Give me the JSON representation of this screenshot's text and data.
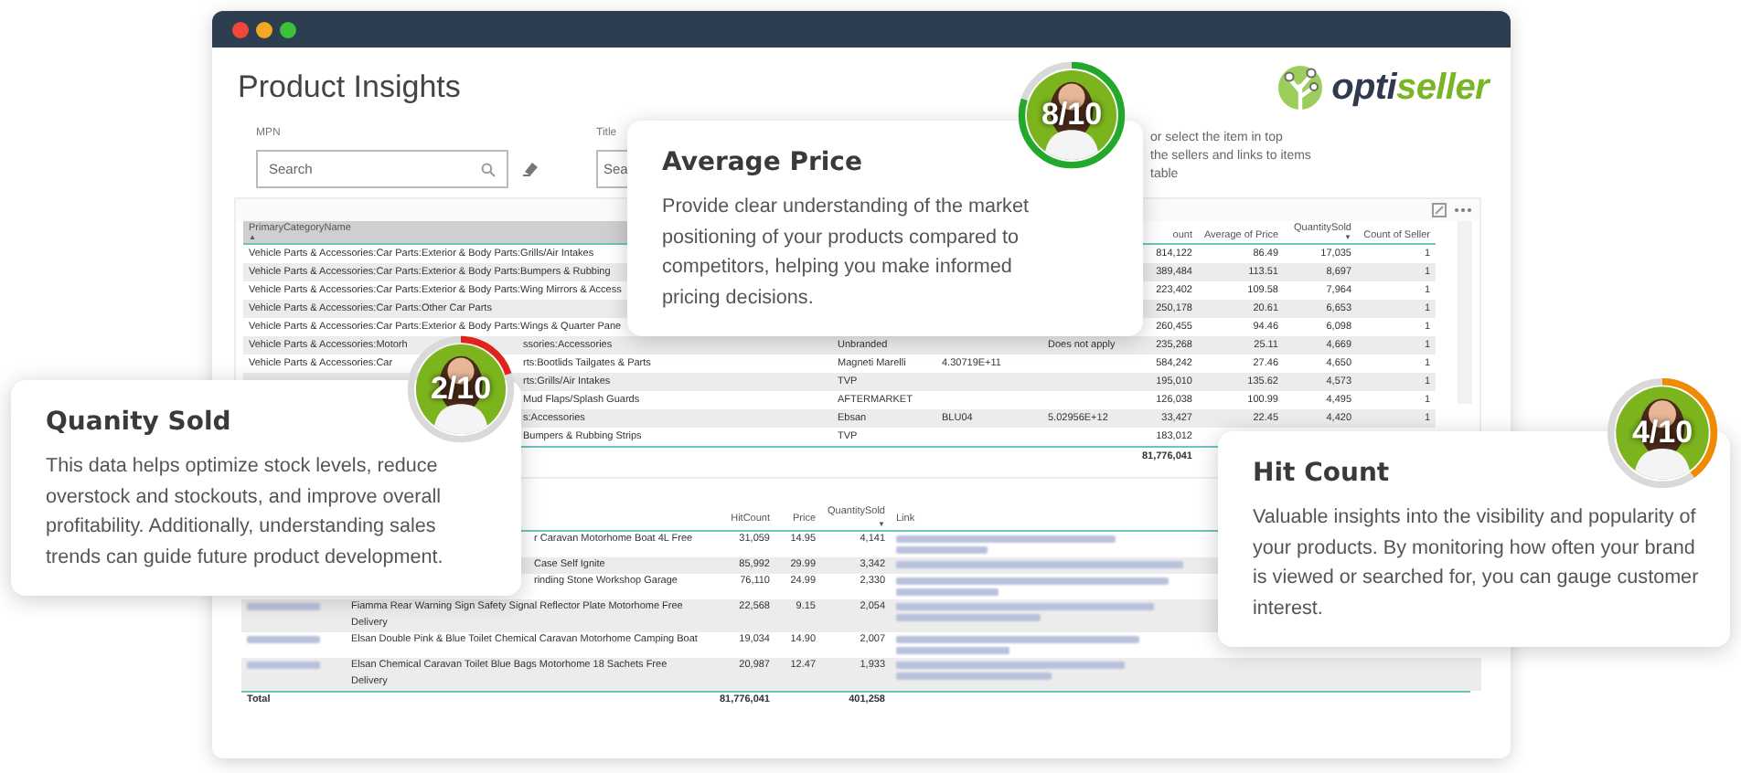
{
  "window": {
    "title": "Product Insights"
  },
  "logo": {
    "part_1": "opti",
    "part_2": "seller"
  },
  "filters": [
    {
      "label": "MPN",
      "placeholder": "Search"
    },
    {
      "label": "Title",
      "placeholder": "Sea"
    }
  ],
  "hint": [
    "or select the item in top",
    "the sellers and links to items",
    "table"
  ],
  "top_table": {
    "header": {
      "column_1": "PrimaryCategoryName",
      "column_5": "ount",
      "column_6": "Average of Price",
      "column_7": "QuantitySold",
      "column_8": "Count of Seller"
    },
    "sort_marks": {
      "column_1": "▲",
      "column_7": "▼"
    },
    "rows": [
      {
        "column_1": {
          "lead": "Vehicle Parts & Accessories:Car Parts:Exterior & Body Parts:Grills/Air Intakes"
        },
        "column_5": "814,122",
        "column_6": "86.49",
        "column_7": "17,035",
        "column_8": "1"
      },
      {
        "column_1": {
          "lead": "Vehicle Parts & Accessories:Car Parts:Exterior & Body Parts:Bumpers & Rubbing"
        },
        "column_5": "389,484",
        "column_6": "113.51",
        "column_7": "8,697",
        "column_8": "1"
      },
      {
        "column_1": {
          "lead": "Vehicle Parts & Accessories:Car Parts:Exterior & Body Parts:Wing Mirrors & Access"
        },
        "column_5": "223,402",
        "column_6": "109.58",
        "column_7": "7,964",
        "column_8": "1"
      },
      {
        "column_1": {
          "lead": "Vehicle Parts & Accessories:Car Parts:Other Car Parts"
        },
        "column_5": "250,178",
        "column_6": "20.61",
        "column_7": "6,653",
        "column_8": "1"
      },
      {
        "column_1": {
          "lead": "Vehicle Parts & Accessories:Car Parts:Exterior & Body Parts:Wings & Quarter Pane"
        },
        "column_5": "260,455",
        "column_6": "94.46",
        "column_7": "6,098",
        "column_8": "1"
      },
      {
        "column_1": {
          "lead": "Vehicle Parts & Accessories:Motorh",
          "tail": "ssories:Accessories"
        },
        "column_2": "Unbranded",
        "column_4": "Does not apply",
        "column_5": "235,268",
        "column_6": "25.11",
        "column_7": "4,669",
        "column_8": "1"
      },
      {
        "column_1": {
          "lead": "Vehicle Parts & Accessories:Car",
          "tail": "rts:Bootlids Tailgates & Parts"
        },
        "column_2": "Magneti Marelli",
        "column_3": "4.30719E+11",
        "column_5": "584,242",
        "column_6": "27.46",
        "column_7": "4,650",
        "column_8": "1"
      },
      {
        "column_1": {
          "tail": "rts:Grills/Air Intakes"
        },
        "column_2": "TVP",
        "column_5": "195,010",
        "column_6": "135.62",
        "column_7": "4,573",
        "column_8": "1"
      },
      {
        "column_1": {
          "tail": "Mud Flaps/Splash Guards"
        },
        "column_2": "AFTERMARKET",
        "column_5": "126,038",
        "column_6": "100.99",
        "column_7": "4,495",
        "column_8": "1"
      },
      {
        "column_1": {
          "tail": "s:Accessories"
        },
        "column_2": "Ebsan",
        "column_3": "BLU04",
        "column_4": "5.02956E+12",
        "column_5": "33,427",
        "column_6": "22.45",
        "column_7": "4,420",
        "column_8": "1"
      },
      {
        "column_1": {
          "tail": "Bumpers & Rubbing Strips"
        },
        "column_2": "TVP",
        "column_5": "183,012"
      }
    ],
    "total": {
      "column_5": "81,776,041"
    }
  },
  "bottom_table": {
    "header": {
      "column_3": "HitCount",
      "column_4": "Price",
      "column_5": "QuantitySold",
      "column_6": "Link"
    },
    "sort_marks": {
      "column_5": "▼"
    },
    "rows": [
      {
        "column_2": {
          "tail": "r Caravan Motorhome Boat 4L Free"
        },
        "column_3": "31,059",
        "column_4": "14.95",
        "column_5": "4,141"
      },
      {
        "column_2": {
          "tail": "Case Self Ignite"
        },
        "column_3": "85,992",
        "column_4": "29.99",
        "column_5": "3,342"
      },
      {
        "column_2": {
          "tail": "rinding Stone Workshop Garage"
        },
        "column_3": "76,110",
        "column_4": "24.99",
        "column_5": "2,330"
      },
      {
        "column_2": {
          "lead": "Fiamma Rear Warning Sign Safety Signal Reflector Plate Motorhome Free Delivery"
        },
        "column_3": "22,568",
        "column_4": "9.15",
        "column_5": "2,054"
      },
      {
        "column_2": {
          "lead": "Elsan Double Pink & Blue Toilet Chemical Caravan Motorhome Camping Boat"
        },
        "column_3": "19,034",
        "column_4": "14.90",
        "column_5": "2,007"
      },
      {
        "column_2": {
          "lead": "Elsan Chemical Caravan Toilet Blue Bags Motorhome 18 Sachets Free Delivery"
        },
        "column_3": "20,987",
        "column_4": "12.47",
        "column_5": "1,933"
      }
    ],
    "total": {
      "column_1": "Total",
      "column_3": "81,776,041",
      "column_5": "401,258"
    }
  },
  "callouts": [
    {
      "title": "Average Price",
      "text": "Provide clear understanding of the market positioning of your products compared to competitors, helping you make informed pricing decisions.",
      "score": "8/10",
      "level": 0.8,
      "color": "#22a82a"
    },
    {
      "title": "Quanity Sold",
      "text": "This data helps optimize stock levels, reduce overstock and stockouts, and improve overall profitability. Additionally, understanding sales trends can guide future product development.",
      "score": "2/10",
      "level": 0.2,
      "color": "#e3221e"
    },
    {
      "title": "Hit Count",
      "text": "Valuable insights into the visibility and popularity of your products. By monitoring how often your brand is viewed or searched for, you can gauge customer interest.",
      "score": "4/10",
      "level": 0.4,
      "color": "#f08a00"
    }
  ]
}
